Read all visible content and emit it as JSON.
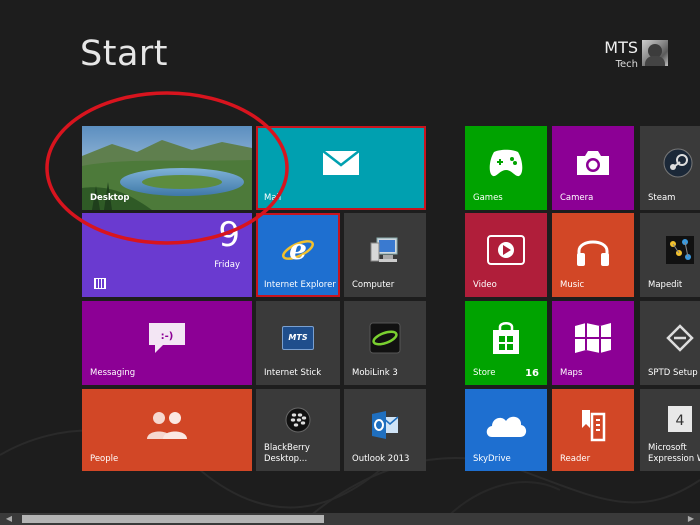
{
  "header": {
    "title": "Start"
  },
  "user": {
    "name": "MTS",
    "subtitle": "Tech"
  },
  "tiles": {
    "desktop": {
      "label": "Desktop"
    },
    "mail": {
      "label": "Mail"
    },
    "calendar": {
      "day_number": "9",
      "day_name": "Friday"
    },
    "internet_explorer": {
      "label": "Internet Explorer"
    },
    "computer": {
      "label": "Computer"
    },
    "messaging": {
      "label": "Messaging"
    },
    "internet_stick": {
      "label": "Internet Stick",
      "logo_text": "MTS"
    },
    "mobilink": {
      "label": "MobiLink 3"
    },
    "people": {
      "label": "People"
    },
    "blackberry": {
      "label_line1": "BlackBerry",
      "label_line2": "Desktop..."
    },
    "outlook": {
      "label": "Outlook 2013"
    },
    "games": {
      "label": "Games"
    },
    "camera": {
      "label": "Camera"
    },
    "steam": {
      "label": "Steam"
    },
    "video": {
      "label": "Video"
    },
    "music": {
      "label": "Music"
    },
    "mapedit": {
      "label": "Mapedit"
    },
    "store": {
      "label": "Store",
      "badge": "16"
    },
    "maps": {
      "label": "Maps"
    },
    "sptd": {
      "label": "SPTD Setup"
    },
    "skydrive": {
      "label": "SkyDrive"
    },
    "reader": {
      "label": "Reader"
    },
    "expression": {
      "label_line1": "Microsoft",
      "label_line2": "Expression We"
    }
  },
  "colors": {
    "background": "#1d1d1d",
    "mail": "#00a0b0",
    "purple": "#7c2db0",
    "calendar": "#6a3ad0",
    "orange": "#d24726",
    "green": "#00a300",
    "magenta": "#8c0095",
    "red": "#b01e3a",
    "blue": "#1e7ae0",
    "dark_tile": "#3a3a3a",
    "selection_outline": "#c8141e"
  }
}
